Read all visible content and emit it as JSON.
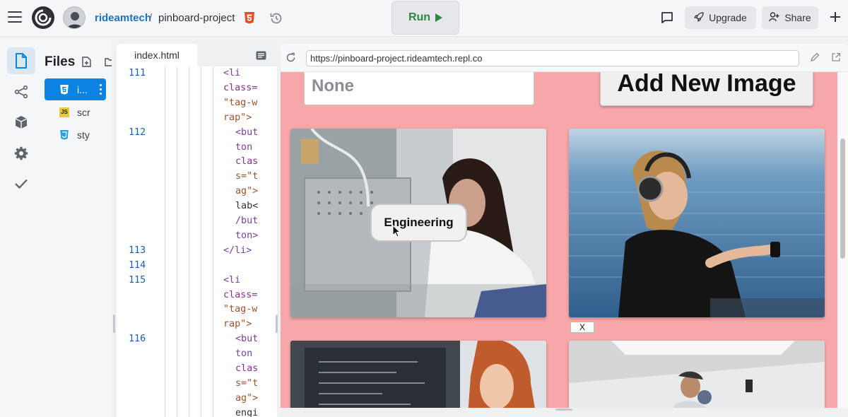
{
  "topbar": {
    "user": "rideamtech",
    "separator": "/",
    "project": "pinboard-project",
    "run_label": "Run",
    "upgrade_label": "Upgrade",
    "share_label": "Share"
  },
  "files": {
    "title": "Files",
    "items": [
      {
        "name": "i...",
        "icon": "html5-icon",
        "active": true
      },
      {
        "name": "scr",
        "icon": "js-file-icon",
        "badge": "JS",
        "active": false
      },
      {
        "name": "sty",
        "icon": "css3-icon",
        "active": false
      }
    ]
  },
  "editor": {
    "tab": "index.html",
    "lines": [
      {
        "num": "111",
        "text": "<li"
      },
      {
        "num": "",
        "text": "class="
      },
      {
        "num": "",
        "text": "\"tag-w"
      },
      {
        "num": "",
        "text": "rap\">"
      },
      {
        "num": "112",
        "text": "<but"
      },
      {
        "num": "",
        "text": "ton"
      },
      {
        "num": "",
        "text": "clas"
      },
      {
        "num": "",
        "text": "s=\"t"
      },
      {
        "num": "",
        "text": "ag\">"
      },
      {
        "num": "",
        "text": "lab<"
      },
      {
        "num": "",
        "text": "/but"
      },
      {
        "num": "",
        "text": "ton>"
      },
      {
        "num": "113",
        "text": "</li>"
      },
      {
        "num": "114",
        "text": ""
      },
      {
        "num": "115",
        "text": "<li"
      },
      {
        "num": "",
        "text": "class="
      },
      {
        "num": "",
        "text": "\"tag-w"
      },
      {
        "num": "",
        "text": "rap\">"
      },
      {
        "num": "116",
        "text": "<but"
      },
      {
        "num": "",
        "text": "ton"
      },
      {
        "num": "",
        "text": "clas"
      },
      {
        "num": "",
        "text": "s=\"t"
      },
      {
        "num": "",
        "text": "ag\">"
      },
      {
        "num": "",
        "text": "engi"
      }
    ]
  },
  "webview": {
    "url": "https://pinboard-project.rideamtech.repl.co",
    "select_value": "None",
    "add_button": "Add New Image",
    "tag_label": "Engineering",
    "remove_label": "X",
    "background": "#f8a7a9"
  }
}
